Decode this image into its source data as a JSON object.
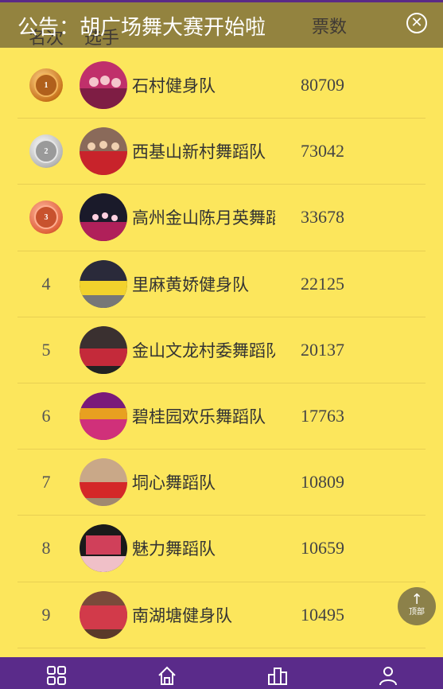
{
  "notice": {
    "text": "公告：胡广场舞大赛开始啦",
    "close_label": "✕"
  },
  "columns": {
    "rank": "名次",
    "player": "选手",
    "votes": "票数"
  },
  "rows": [
    {
      "rank": "1",
      "team": "石村健身队",
      "votes": "80709",
      "medal": "gold"
    },
    {
      "rank": "2",
      "team": "西基山新村舞蹈队",
      "votes": "73042",
      "medal": "silver"
    },
    {
      "rank": "3",
      "team": "高州金山陈月英舞蹈队",
      "votes": "33678",
      "medal": "bronze"
    },
    {
      "rank": "4",
      "team": "里麻黄娇健身队",
      "votes": "22125"
    },
    {
      "rank": "5",
      "team": "金山文龙村委舞蹈队",
      "votes": "20137"
    },
    {
      "rank": "6",
      "team": "碧桂园欢乐舞蹈队",
      "votes": "17763"
    },
    {
      "rank": "7",
      "team": "垌心舞蹈队",
      "votes": "10809"
    },
    {
      "rank": "8",
      "team": "魅力舞蹈队",
      "votes": "10659"
    },
    {
      "rank": "9",
      "team": "南湖塘健身队",
      "votes": "10495"
    }
  ],
  "to_top": {
    "label": "顶部",
    "icon": "arrow-up-icon"
  },
  "nav": {
    "items": [
      {
        "icon": "grid-icon"
      },
      {
        "icon": "home-icon"
      },
      {
        "icon": "ranking-icon"
      },
      {
        "icon": "user-icon"
      }
    ]
  },
  "colors": {
    "background": "#fce65c",
    "nav": "#5a2b8a"
  }
}
